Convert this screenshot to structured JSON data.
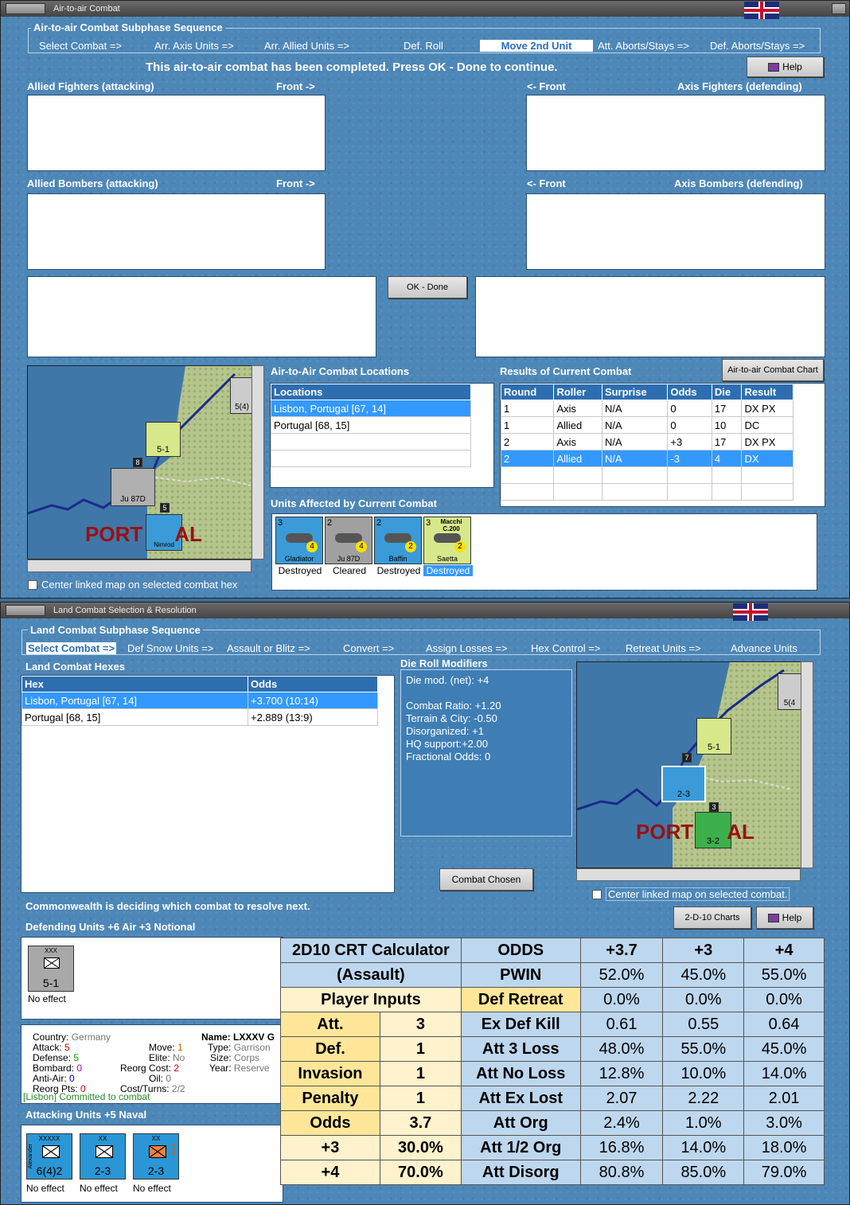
{
  "air": {
    "title": "Air-to-air Combat",
    "subphase_title": "Air-to-air Combat Subphase Sequence",
    "tabs": [
      "Select Combat =>",
      "Arr. Axis Units =>",
      "Arr. Allied Units =>",
      "Def. Roll",
      "Move 2nd Unit",
      "Att. Aborts/Stays =>",
      "Def. Aborts/Stays =>"
    ],
    "message": "This air-to-air combat has been completed.  Press OK - Done to continue.",
    "help": "Help",
    "allied_fighters": "Allied Fighters (attacking)",
    "front_right": "Front ->",
    "front_left": "<- Front",
    "axis_fighters": "Axis Fighters (defending)",
    "allied_bombers": "Allied Bombers (attacking)",
    "axis_bombers": "Axis Bombers (defending)",
    "ok_done": "OK - Done",
    "locations_title": "Air-to-Air Combat Locations",
    "locations_header": "Locations",
    "locations": [
      "Lisbon, Portugal [67, 14]",
      "Portugal [68, 15]"
    ],
    "results_title": "Results of Current Combat",
    "chart_btn": "Air-to-air Combat Chart",
    "results_headers": [
      "Round",
      "Roller",
      "Surprise",
      "Odds",
      "Die",
      "Result"
    ],
    "results": [
      [
        "1",
        "Axis",
        "N/A",
        "0",
        "17",
        "DX PX"
      ],
      [
        "1",
        "Allied",
        "N/A",
        "0",
        "10",
        "DC"
      ],
      [
        "2",
        "Axis",
        "N/A",
        "+3",
        "17",
        "DX PX"
      ],
      [
        "2",
        "Allied",
        "N/A",
        "-3",
        "4",
        "DX"
      ]
    ],
    "units_title": "Units Affected by Current Combat",
    "units": [
      {
        "name": "Gladiator",
        "top": "3",
        "br": "4",
        "result": "Destroyed",
        "color": "#3a9bd8"
      },
      {
        "name": "Ju 87D",
        "top": "2",
        "br": "4",
        "result": "Cleared",
        "color": "#a0a0a0"
      },
      {
        "name": "Baffin",
        "top": "2",
        "br": "2",
        "result": "Destroyed",
        "color": "#3a9bd8"
      },
      {
        "name": "Saetta",
        "top": "3",
        "br": "2",
        "result": "Destroyed",
        "color": "#d6e88a",
        "label": "Macchi C.200"
      }
    ],
    "center_map": "Center linked map on selected combat hex",
    "map_label": "PORT",
    "map_label2": "AL",
    "map_counters": {
      "xvi": "XVI Garr",
      "xvi_val": "5-1",
      "ju": "Ju 87D",
      "nimrod": "Nimrod",
      "stack_a": "8",
      "stack_b": "5",
      "corner": "5(4)"
    }
  },
  "land": {
    "title": "Land Combat Selection & Resolution",
    "subphase_title": "Land Combat Subphase Sequence",
    "tabs": [
      "Select Combat =>",
      "Def Snow Units =>",
      "Assault or Blitz =>",
      "Convert =>",
      "Assign Losses =>",
      "Hex Control =>",
      "Retreat Units =>",
      "Advance Units"
    ],
    "hexes_title": "Land Combat Hexes",
    "hexes_headers": [
      "Hex",
      "Odds"
    ],
    "hexes": [
      [
        "Lisbon, Portugal [67, 14]",
        "+3.700 (10:14)"
      ],
      [
        "Portugal [68, 15]",
        "+2.889 (13:9)"
      ]
    ],
    "die_title": "Die Roll Modifiers",
    "die_lines": [
      "Die mod. (net): +4",
      "",
      "Combat Ratio: +1.20",
      "Terrain & City: -0.50",
      "Disorganized: +1",
      "HQ support:+2.00",
      "Fractional Odds: 0"
    ],
    "combat_chosen": "Combat Chosen",
    "center_map": "Center linked map on selected combat.",
    "charts_btn": "2-D-10 Charts",
    "help": "Help",
    "status": "Commonwealth is deciding which combat to resolve next.",
    "defending_title": "Defending Units +6 Air +3 Notional",
    "defender": {
      "name": "LXXXV Garr",
      "val": "5-1",
      "size": "XXX",
      "result": "No effect"
    },
    "info": {
      "country_l": "Country:",
      "country_v": "Germany",
      "attack_l": "Attack:",
      "attack_v": "5",
      "defense_l": "Defense:",
      "defense_v": "5",
      "bombard_l": "Bombard:",
      "bombard_v": "0",
      "antiair_l": "Anti-Air:",
      "antiair_v": "0",
      "reorg_l": "Reorg Pts:",
      "reorg_v": "0",
      "move_l": "Move:",
      "move_v": "1",
      "elite_l": "Elite:",
      "elite_v": "No",
      "reorgcost_l": "Reorg Cost:",
      "reorgcost_v": "2",
      "oil_l": "Oil:",
      "oil_v": "0",
      "cost_l": "Cost/Turns:",
      "cost_v": "2/2",
      "name_l": "Name:",
      "name_v": "LXXXV G",
      "type_l": "Type:",
      "type_v": "Garrison",
      "size_l": "Size:",
      "size_v": "Corps",
      "year_l": "Year:",
      "year_v": "Reserve",
      "committed": "[Lisbon] Committed to combat"
    },
    "attacking_title": "Attacking Units +5 Naval",
    "attackers": [
      {
        "name": "Alexander",
        "val": "6(4)2",
        "size": "XXXXX",
        "result": "No effect"
      },
      {
        "name": "",
        "val": "2-3",
        "size": "XX",
        "result": "No effect"
      },
      {
        "name": "RSA",
        "val": "2-3",
        "size": "XX",
        "result": "No effect"
      }
    ],
    "map_label": "PORT",
    "map_label2": "AL",
    "map_counters": {
      "xvi": "XVI Garr",
      "xvi_val": "5-1",
      "a": "2-3",
      "m": "3-2",
      "stack_a": "7",
      "stack_b": "3",
      "corner": "5(4"
    }
  },
  "calc": {
    "title1": "2D10 CRT Calculator",
    "title2": "(Assault)",
    "player_inputs": "Player Inputs",
    "inputs": [
      [
        "Att.",
        "3"
      ],
      [
        "Def.",
        "1"
      ],
      [
        "Invasion",
        "1"
      ],
      [
        "Penalty",
        "1"
      ],
      [
        "Odds",
        "3.7"
      ],
      [
        "+3",
        "30.0%"
      ],
      [
        "+4",
        "70.0%"
      ]
    ],
    "headers": [
      "ODDS",
      "+3.7",
      "+3",
      "+4"
    ],
    "rows": [
      [
        "PWIN",
        "52.0%",
        "45.0%",
        "55.0%"
      ],
      [
        "Def Retreat",
        "0.0%",
        "0.0%",
        "0.0%"
      ],
      [
        "Ex Def Kill",
        "0.61",
        "0.55",
        "0.64"
      ],
      [
        "Att 3 Loss",
        "48.0%",
        "55.0%",
        "45.0%"
      ],
      [
        "Att No Loss",
        "12.8%",
        "10.0%",
        "14.0%"
      ],
      [
        "Att Ex Lost",
        "2.07",
        "2.22",
        "2.01"
      ],
      [
        "Att Org",
        "2.4%",
        "1.0%",
        "3.0%"
      ],
      [
        "Att 1/2 Org",
        "16.8%",
        "14.0%",
        "18.0%"
      ],
      [
        "Att Disorg",
        "80.8%",
        "85.0%",
        "79.0%"
      ]
    ]
  }
}
